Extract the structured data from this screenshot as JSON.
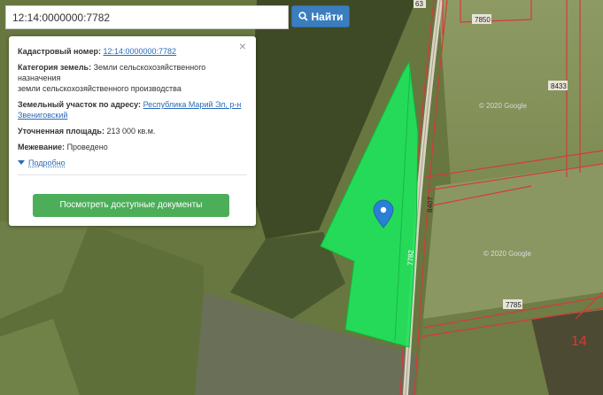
{
  "search": {
    "value": "12:14:0000000:7782",
    "button_label": "Найти"
  },
  "popup": {
    "cadastral_label": "Кадастровый номер:",
    "cadastral_value": "12:14:0000000:7782",
    "category_label": "Категория земель:",
    "category_value": "Земли сельскохозяйственного назначения",
    "category_value_2": "земли сельскохозяйственного производства",
    "address_label": "Земельный участок по адресу:",
    "address_value": "Республика Марий Эл, р-н Звениговский",
    "area_label": "Уточненная площадь:",
    "area_value": "213 000 кв.м.",
    "survey_label": "Межевание:",
    "survey_value": "Проведено",
    "more_label": "Подробно",
    "docs_button": "Посмотреть доступные документы",
    "close_symbol": "×"
  },
  "map": {
    "road_labels": [
      "63",
      "8407",
      "7782",
      "7850",
      "8433",
      "7785"
    ],
    "parcel_number": "14",
    "copyright": "© 2020 Google",
    "colors": {
      "parcel_fill": "#1fe35a",
      "boundary": "#d63a3a",
      "marker": "#2b7fd4",
      "search_button": "#3b7ebf",
      "docs_button": "#4dae59"
    }
  }
}
